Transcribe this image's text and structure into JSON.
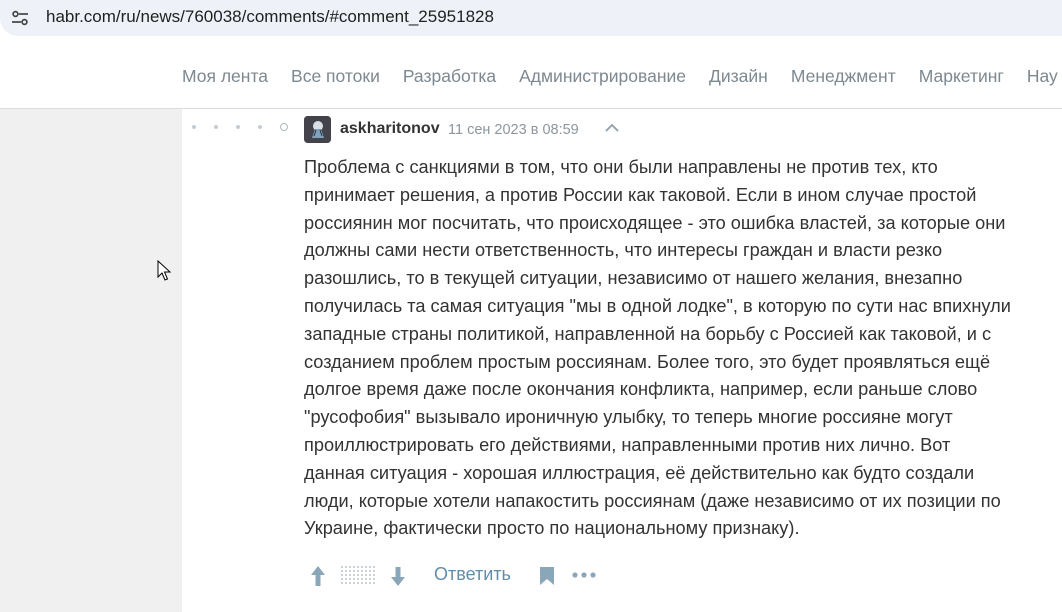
{
  "browser": {
    "url": "habr.com/ru/news/760038/comments/#comment_25951828"
  },
  "nav": {
    "items": [
      "Моя лента",
      "Все потоки",
      "Разработка",
      "Администрирование",
      "Дизайн",
      "Менеджмент",
      "Маркетинг",
      "Нау"
    ]
  },
  "comment": {
    "author": "askharitonov",
    "date": "11 сен 2023 в 08:59",
    "text": "Проблема с санкциями в том, что они были направлены не против тех, кто\nпринимает решения, а против России как таковой. Если в ином случае простой\nроссиянин мог посчитать, что происходящее - это ошибка властей, за которые они\nдолжны сами нести ответственность, что интересы граждан и власти резко\nразошлись, то в текущей ситуации, независимо от нашего желания, внезапно\nполучилась та самая ситуация \"мы в одной лодке\", в которую по сути нас впихнули\nзападные страны политикой, направленной на борьбу с Россией как таковой, и с\nсозданием проблем простым россиянам. Более того, это будет проявляться ещё\nдолгое время даже после окончания конфликта, например, если раньше слово\n\"русофобия\" вызывало ироничную улыбку, то теперь многие россияне могут\nпроиллюстрировать его действиями, направленными против них лично. Вот\nданная ситуация - хорошая иллюстрация, её действительно как будто создали\nлюди, которые хотели напакостить россиянам (даже независимо от их позиции по\nУкраине, фактически просто по национальному признаку).",
    "reply_label": "Ответить"
  },
  "icons": {
    "site_info": "tune-icon",
    "collapse": "chevron-up-icon",
    "vote_up": "arrow-up-icon",
    "vote_down": "arrow-down-icon",
    "bookmark": "bookmark-icon",
    "more": "more-horizontal-icon",
    "cursor": "mouse-pointer-icon"
  },
  "colors": {
    "link": "#5e8eac",
    "nav_text": "#7d8890",
    "page_bg": "#f0f0f0"
  }
}
